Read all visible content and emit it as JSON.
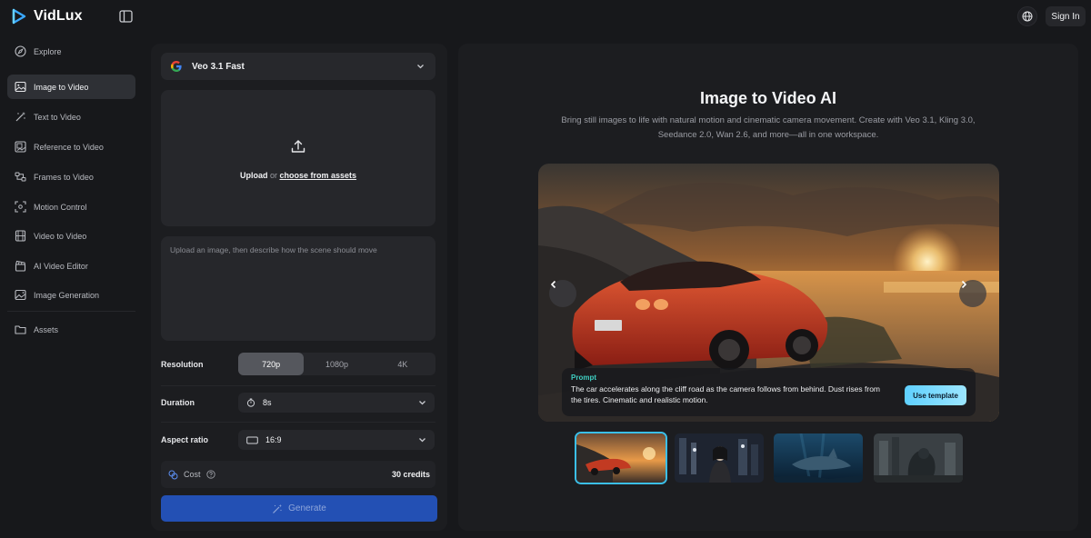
{
  "app": {
    "name": "VidLux"
  },
  "header": {
    "sign_in_label": "Sign In"
  },
  "sidebar": {
    "items": [
      {
        "label": "Explore",
        "icon": "compass-icon"
      },
      {
        "label": "Image to Video",
        "icon": "image-icon",
        "active": true
      },
      {
        "label": "Text to Video",
        "icon": "magic-wand-icon"
      },
      {
        "label": "Reference to Video",
        "icon": "image-reference-icon"
      },
      {
        "label": "Frames to Video",
        "icon": "frames-icon"
      },
      {
        "label": "Motion Control",
        "icon": "motion-control-icon"
      },
      {
        "label": "Video to Video",
        "icon": "film-icon"
      },
      {
        "label": "AI Video Editor",
        "icon": "clapperboard-icon"
      },
      {
        "label": "Image Generation",
        "icon": "image-sparkle-icon"
      },
      {
        "label": "Assets",
        "icon": "folder-icon"
      }
    ]
  },
  "form": {
    "model": {
      "name": "Veo 3.1 Fast",
      "icon": "google-icon"
    },
    "upload": {
      "upload_label": "Upload",
      "or_label": "or",
      "choose_label": "choose from assets"
    },
    "prompt": {
      "placeholder": "Upload an image, then describe how the scene should move"
    },
    "resolution": {
      "label": "Resolution",
      "options": [
        "720p",
        "1080p",
        "4K"
      ],
      "selected": "720p"
    },
    "duration": {
      "label": "Duration",
      "value": "8s"
    },
    "aspect_ratio": {
      "label": "Aspect ratio",
      "value": "16:9"
    },
    "cost": {
      "label": "Cost",
      "value": "30 credits"
    },
    "generate_label": "Generate"
  },
  "showcase": {
    "title": "Image to Video AI",
    "description": "Bring still images to life with natural motion and cinematic camera movement. Create with Veo 3.1, Kling 3.0, Seedance 2.0, Wan 2.6, and more—all in one workspace.",
    "prompt_card": {
      "title": "Prompt",
      "text": "The car accelerates along the cliff road as the camera follows from behind. Dust rises from the tires. Cinematic and realistic motion.",
      "button_label": "Use template"
    },
    "thumbnails": [
      {
        "subject": "sports-car-sunset",
        "selected": true
      },
      {
        "subject": "woman-city-night",
        "selected": false
      },
      {
        "subject": "underwater-creature",
        "selected": false
      },
      {
        "subject": "creature-ruins",
        "selected": false
      }
    ]
  }
}
